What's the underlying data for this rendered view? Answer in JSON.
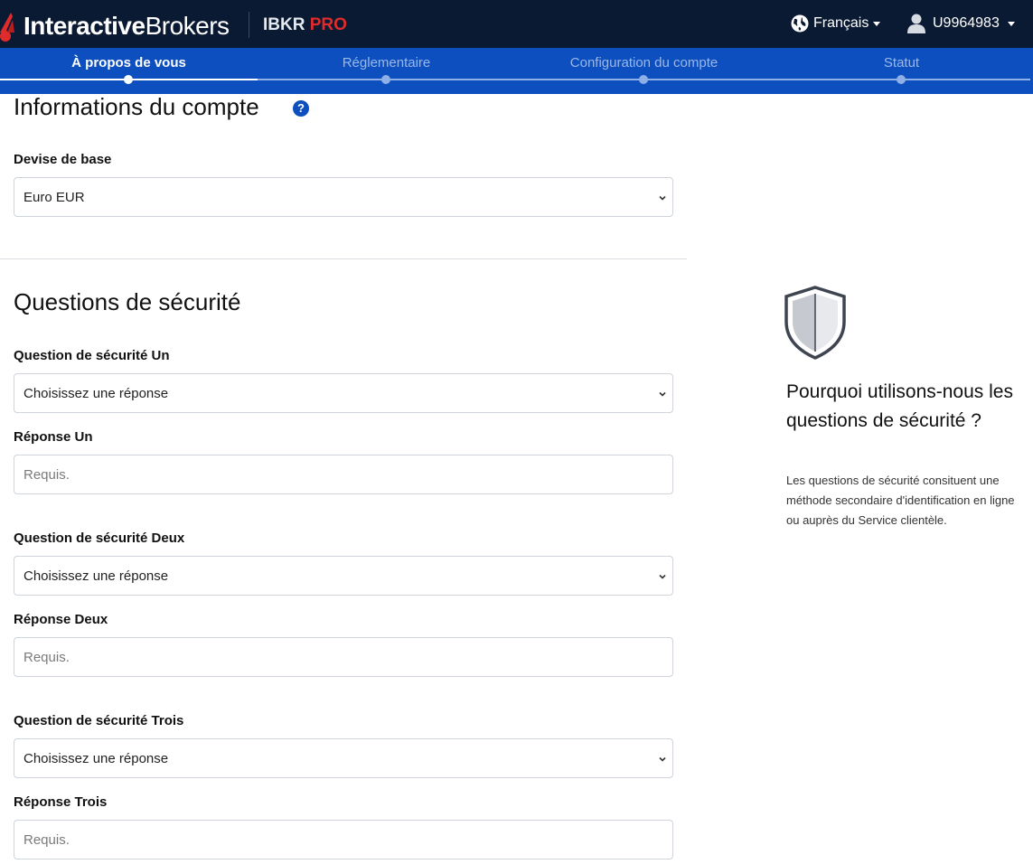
{
  "header": {
    "logo_bold": "Interactive",
    "logo_light": "Brokers",
    "product_a": "IBKR",
    "product_b": "PRO",
    "language": "Français",
    "user": "U9964983"
  },
  "steps": [
    {
      "label": "À propos de vous",
      "active": true
    },
    {
      "label": "Réglementaire",
      "active": false
    },
    {
      "label": "Configuration du compte",
      "active": false
    },
    {
      "label": "Statut",
      "active": false
    }
  ],
  "account_info": {
    "title": "Informations du compte",
    "help_glyph": "?",
    "currency_label": "Devise de base",
    "currency_value": "Euro EUR"
  },
  "security": {
    "title": "Questions de sécurité",
    "q1_label": "Question de sécurité Un",
    "q1_value": "Choisissez une réponse",
    "a1_label": "Réponse Un",
    "a1_placeholder": "Requis.",
    "q2_label": "Question de sécurité Deux",
    "q2_value": "Choisissez une réponse",
    "a2_label": "Réponse Deux",
    "a2_placeholder": "Requis.",
    "q3_label": "Question de sécurité Trois",
    "q3_value": "Choisissez une réponse",
    "a3_label": "Réponse Trois",
    "a3_placeholder": "Requis."
  },
  "sidebar": {
    "icon": "shield-icon",
    "title": "Pourquoi utilisons-nous les questions de sécurité ?",
    "text": "Les questions de sécurité consituent une méthode secondaire d'identification en ligne ou auprès du Service clientèle."
  },
  "colors": {
    "topbar": "#0b1a33",
    "stepbar": "#0d4fbf",
    "brand_red": "#e02b2b"
  }
}
